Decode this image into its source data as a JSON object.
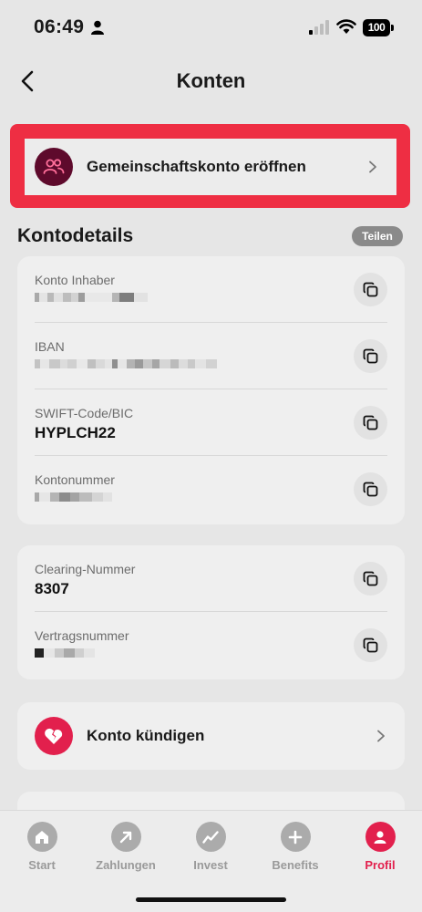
{
  "status_bar": {
    "time": "06:49",
    "battery": "100"
  },
  "header": {
    "title": "Konten",
    "back_icon": "chevron-left-icon"
  },
  "joint_account": {
    "label": "Gemeinschaftskonto eröffnen",
    "icon": "people-icon",
    "highlight_color": "#ee2e43"
  },
  "details_section": {
    "title": "Kontodetails",
    "share_label": "Teilen"
  },
  "details_card_1": {
    "rows": [
      {
        "label": "Konto Inhaber",
        "value": ""
      },
      {
        "label": "IBAN",
        "value": ""
      },
      {
        "label": "SWIFT-Code/BIC",
        "value": "HYPLCH22"
      },
      {
        "label": "Kontonummer",
        "value": ""
      }
    ]
  },
  "details_card_2": {
    "rows": [
      {
        "label": "Clearing-Nummer",
        "value": "8307"
      },
      {
        "label": "Vertragsnummer",
        "value": ""
      }
    ]
  },
  "close_account": {
    "label": "Konto kündigen",
    "icon": "broken-heart-icon"
  },
  "tab_bar": {
    "tabs": [
      {
        "label": "Start",
        "icon": "home-icon"
      },
      {
        "label": "Zahlungen",
        "icon": "arrow-up-right-icon"
      },
      {
        "label": "Invest",
        "icon": "trend-line-icon"
      },
      {
        "label": "Benefits",
        "icon": "plus-icon"
      },
      {
        "label": "Profil",
        "icon": "user-icon"
      }
    ],
    "active_tab": "Profil",
    "accent_color": "#e2204d"
  }
}
